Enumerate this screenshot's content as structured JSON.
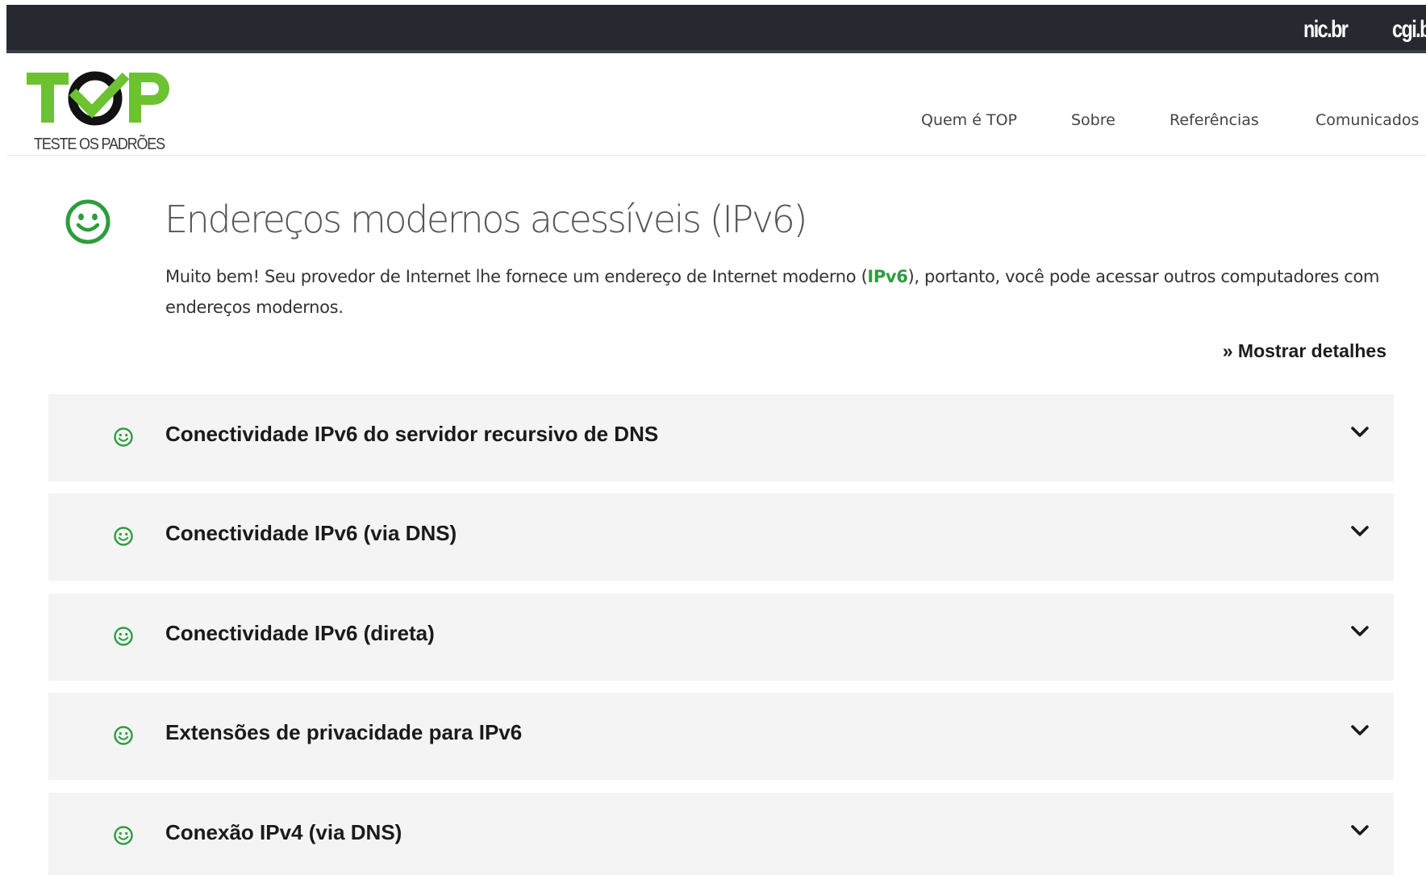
{
  "topbar": {
    "partners": [
      "nic.br",
      "cgi.br"
    ]
  },
  "header": {
    "logo_text": "TOP",
    "logo_subtitle": "TESTE OS PADRÕES",
    "nav": [
      "Quem é TOP",
      "Sobre",
      "Referências",
      "Comunicados"
    ]
  },
  "main": {
    "title": "Endereços modernos acessíveis (IPv6)",
    "description_before": "Muito bem! Seu provedor de Internet lhe fornece um endereço de Internet moderno (",
    "description_highlight": "IPv6",
    "description_after": "), portanto, você pode acessar outros computadores com endereços modernos.",
    "details_link": "» Mostrar detalhes"
  },
  "accordion": [
    {
      "label": "Conectividade IPv6 do servidor recursivo de DNS",
      "status": "success"
    },
    {
      "label": "Conectividade IPv6 (via DNS)",
      "status": "success"
    },
    {
      "label": "Conectividade IPv6 (direta)",
      "status": "success"
    },
    {
      "label": "Extensões de privacidade para IPv6",
      "status": "success"
    },
    {
      "label": "Conexão IPv4 (via DNS)",
      "status": "success"
    }
  ],
  "colors": {
    "topbar": "#262a30",
    "success": "#2e9c3e",
    "logo_green": "#6cc230",
    "accordion_bg": "#f4f4f5"
  }
}
